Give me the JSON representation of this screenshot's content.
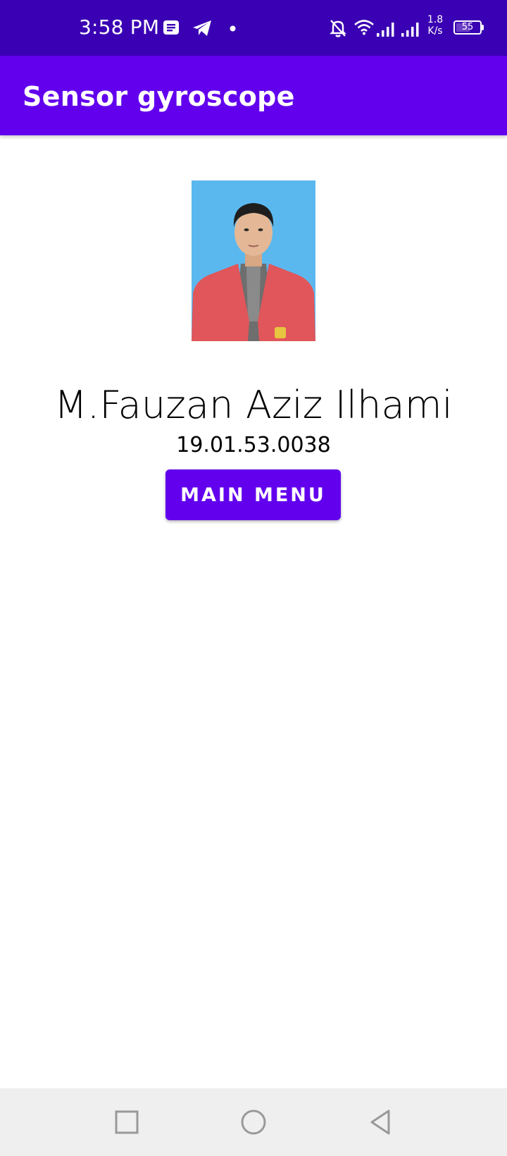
{
  "status_bar": {
    "time": "3:58 PM",
    "net_speed_value": "1.8",
    "net_speed_unit": "K/s",
    "battery_level": "55",
    "icons": [
      "message-icon",
      "telegram-icon",
      "dot-icon",
      "bell-off-icon",
      "wifi-icon",
      "signal-icon",
      "signal-icon"
    ],
    "background_color": "#3a00b3"
  },
  "app_bar": {
    "title": "Sensor gyroscope",
    "background_color": "#6200ee"
  },
  "profile": {
    "name": "M.Fauzan Aziz Ilhami",
    "nim": "19.01.53.0038",
    "photo_background_color": "#5bb8ef"
  },
  "main_button": {
    "label": "MAIN MENU",
    "color": "#6200ee"
  },
  "nav_bar": {
    "buttons": [
      "recent-apps-icon",
      "home-icon",
      "back-icon"
    ]
  }
}
